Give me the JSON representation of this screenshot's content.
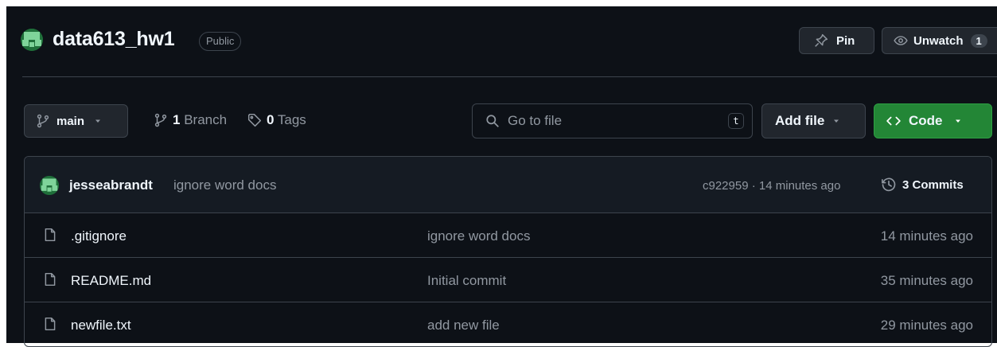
{
  "repo": {
    "name": "data613_hw1",
    "visibility": "Public"
  },
  "header_actions": {
    "pin_label": "Pin",
    "watch_label": "Unwatch",
    "watch_count": "1"
  },
  "toolbar": {
    "branch_name": "main",
    "branch_count": "1",
    "branch_label": "Branch",
    "tag_count": "0",
    "tag_label": "Tags",
    "search_placeholder": "Go to file",
    "search_shortcut": "t",
    "add_file_label": "Add file",
    "code_label": "Code"
  },
  "latest_commit": {
    "author": "jesseabrandt",
    "message": "ignore word docs",
    "sha_and_time": "c922959 · 14 minutes ago",
    "commits_count": "3",
    "commits_label": "Commits"
  },
  "files": [
    {
      "name": ".gitignore",
      "message": "ignore word docs",
      "time": "14 minutes ago"
    },
    {
      "name": "README.md",
      "message": "Initial commit",
      "time": "35 minutes ago"
    },
    {
      "name": "newfile.txt",
      "message": "add new file",
      "time": "29 minutes ago"
    }
  ],
  "icons": [
    "identicon-avatar",
    "pin-icon",
    "eye-icon",
    "git-branch-icon",
    "tag-icon",
    "search-icon",
    "triangle-down-icon",
    "code-icon",
    "history-icon",
    "file-icon"
  ],
  "colors": {
    "background": "#0d1117",
    "border": "#3d444d",
    "muted_text": "#9198a1",
    "primary_button": "#238636",
    "avatar_green": "#1f6f3a"
  }
}
